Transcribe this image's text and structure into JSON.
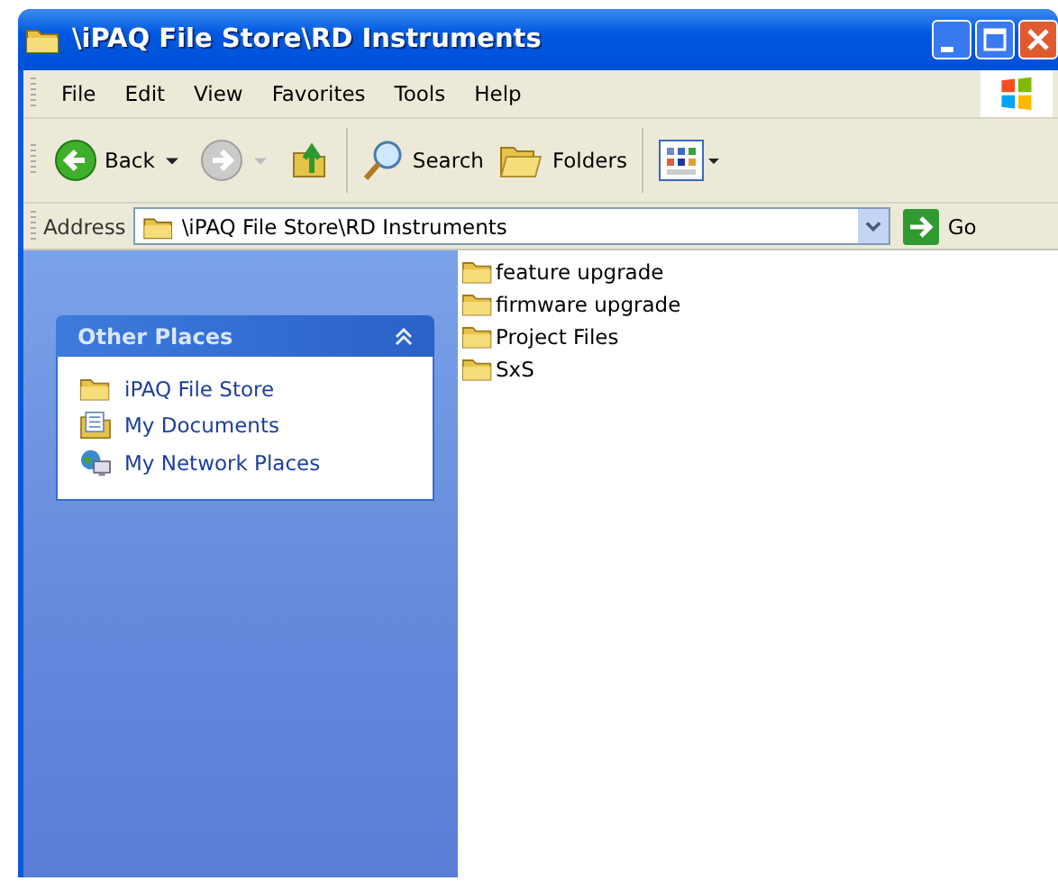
{
  "window": {
    "title": "\\iPAQ File Store\\RD Instruments"
  },
  "menu": [
    {
      "label": "File"
    },
    {
      "label": "Edit"
    },
    {
      "label": "View"
    },
    {
      "label": "Favorites"
    },
    {
      "label": "Tools"
    },
    {
      "label": "Help"
    }
  ],
  "toolbar": [
    {
      "kind": "back",
      "label": "Back"
    },
    {
      "kind": "forward",
      "disabled": true
    },
    {
      "kind": "up"
    },
    {
      "kind": "search",
      "label": "Search"
    },
    {
      "kind": "folders",
      "label": "Folders"
    },
    {
      "kind": "views"
    }
  ],
  "address": {
    "label": "Address",
    "value": "\\iPAQ File Store\\RD Instruments",
    "go": "Go"
  },
  "sidebar": {
    "panels": [
      {
        "title": "Other Places",
        "expanded": true,
        "items": [
          {
            "kind": "folder",
            "label": "iPAQ File Store"
          },
          {
            "kind": "documents",
            "label": "My Documents"
          },
          {
            "kind": "network",
            "label": "My Network Places"
          }
        ]
      }
    ]
  },
  "files": [
    {
      "label": "feature upgrade"
    },
    {
      "label": "firmware upgrade"
    },
    {
      "label": "Project Files"
    },
    {
      "label": "SxS"
    }
  ]
}
